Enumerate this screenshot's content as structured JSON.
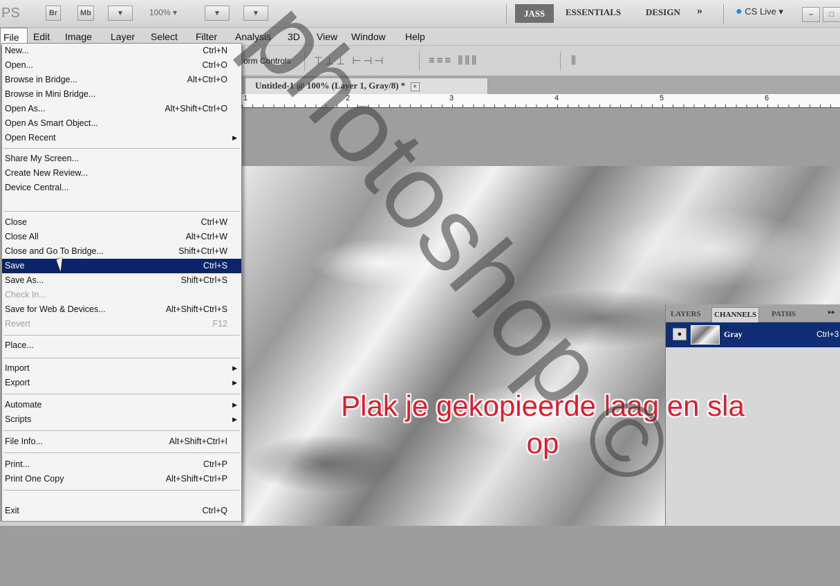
{
  "appbar": {
    "logo": "PS",
    "br_label": "Br",
    "mb_label": "Mb",
    "zoom": "100% ▾",
    "workspace_active": "JASS",
    "workspace_essentials": "ESSENTIALS",
    "workspace_design": "DESIGN",
    "more": "»",
    "cslive": "CS Live ▾"
  },
  "menubar": {
    "items": [
      "File",
      "Edit",
      "Image",
      "Layer",
      "Select",
      "Filter",
      "Analysis",
      "3D",
      "View",
      "Window",
      "Help"
    ]
  },
  "options": {
    "transform_controls": "orm Controls"
  },
  "document": {
    "tab_title": "Untitled-1 @ 100% (Layer 1, Gray/8) *",
    "close": "×"
  },
  "ruler": {
    "ticks": [
      "1",
      "2",
      "3",
      "4",
      "5",
      "6"
    ]
  },
  "file_menu": {
    "items": [
      {
        "label": "New...",
        "shortcut": "Ctrl+N"
      },
      {
        "label": "Open...",
        "shortcut": "Ctrl+O"
      },
      {
        "label": "Browse in Bridge...",
        "shortcut": "Alt+Ctrl+O"
      },
      {
        "label": "Browse in Mini Bridge...",
        "shortcut": ""
      },
      {
        "label": "Open As...",
        "shortcut": "Alt+Shift+Ctrl+O"
      },
      {
        "label": "Open As Smart Object...",
        "shortcut": ""
      },
      {
        "label": "Open Recent",
        "shortcut": ""
      },
      {
        "label": "Share My Screen...",
        "shortcut": ""
      },
      {
        "label": "Create New Review...",
        "shortcut": ""
      },
      {
        "label": "Device Central...",
        "shortcut": ""
      },
      {
        "label": "Close",
        "shortcut": "Ctrl+W"
      },
      {
        "label": "Close All",
        "shortcut": "Alt+Ctrl+W"
      },
      {
        "label": "Close and Go To Bridge...",
        "shortcut": "Shift+Ctrl+W"
      },
      {
        "label": "Save",
        "shortcut": "Ctrl+S"
      },
      {
        "label": "Save As...",
        "shortcut": "Shift+Ctrl+S"
      },
      {
        "label": "Check In...",
        "shortcut": ""
      },
      {
        "label": "Save for Web & Devices...",
        "shortcut": "Alt+Shift+Ctrl+S"
      },
      {
        "label": "Revert",
        "shortcut": "F12"
      },
      {
        "label": "Place...",
        "shortcut": ""
      },
      {
        "label": "Import",
        "shortcut": ""
      },
      {
        "label": "Export",
        "shortcut": ""
      },
      {
        "label": "Automate",
        "shortcut": ""
      },
      {
        "label": "Scripts",
        "shortcut": ""
      },
      {
        "label": "File Info...",
        "shortcut": "Alt+Shift+Ctrl+I"
      },
      {
        "label": "Print...",
        "shortcut": "Ctrl+P"
      },
      {
        "label": "Print One Copy",
        "shortcut": "Alt+Shift+Ctrl+P"
      },
      {
        "label": "Exit",
        "shortcut": "Ctrl+Q"
      }
    ]
  },
  "panel": {
    "tabs": [
      "LAYERS",
      "CHANNELS",
      "PATHS"
    ],
    "more": "▸▸",
    "channel_name": "Gray",
    "channel_shortcut": "Ctrl+3"
  },
  "caption": {
    "line1": "Plak je gekopieerde laag en sla",
    "line2": "op"
  },
  "watermark": "photoshop ©",
  "colors": {
    "menu_selected": "#0c246b",
    "caption_red": "#e21b2d",
    "channel_selected": "#0f2d75"
  }
}
